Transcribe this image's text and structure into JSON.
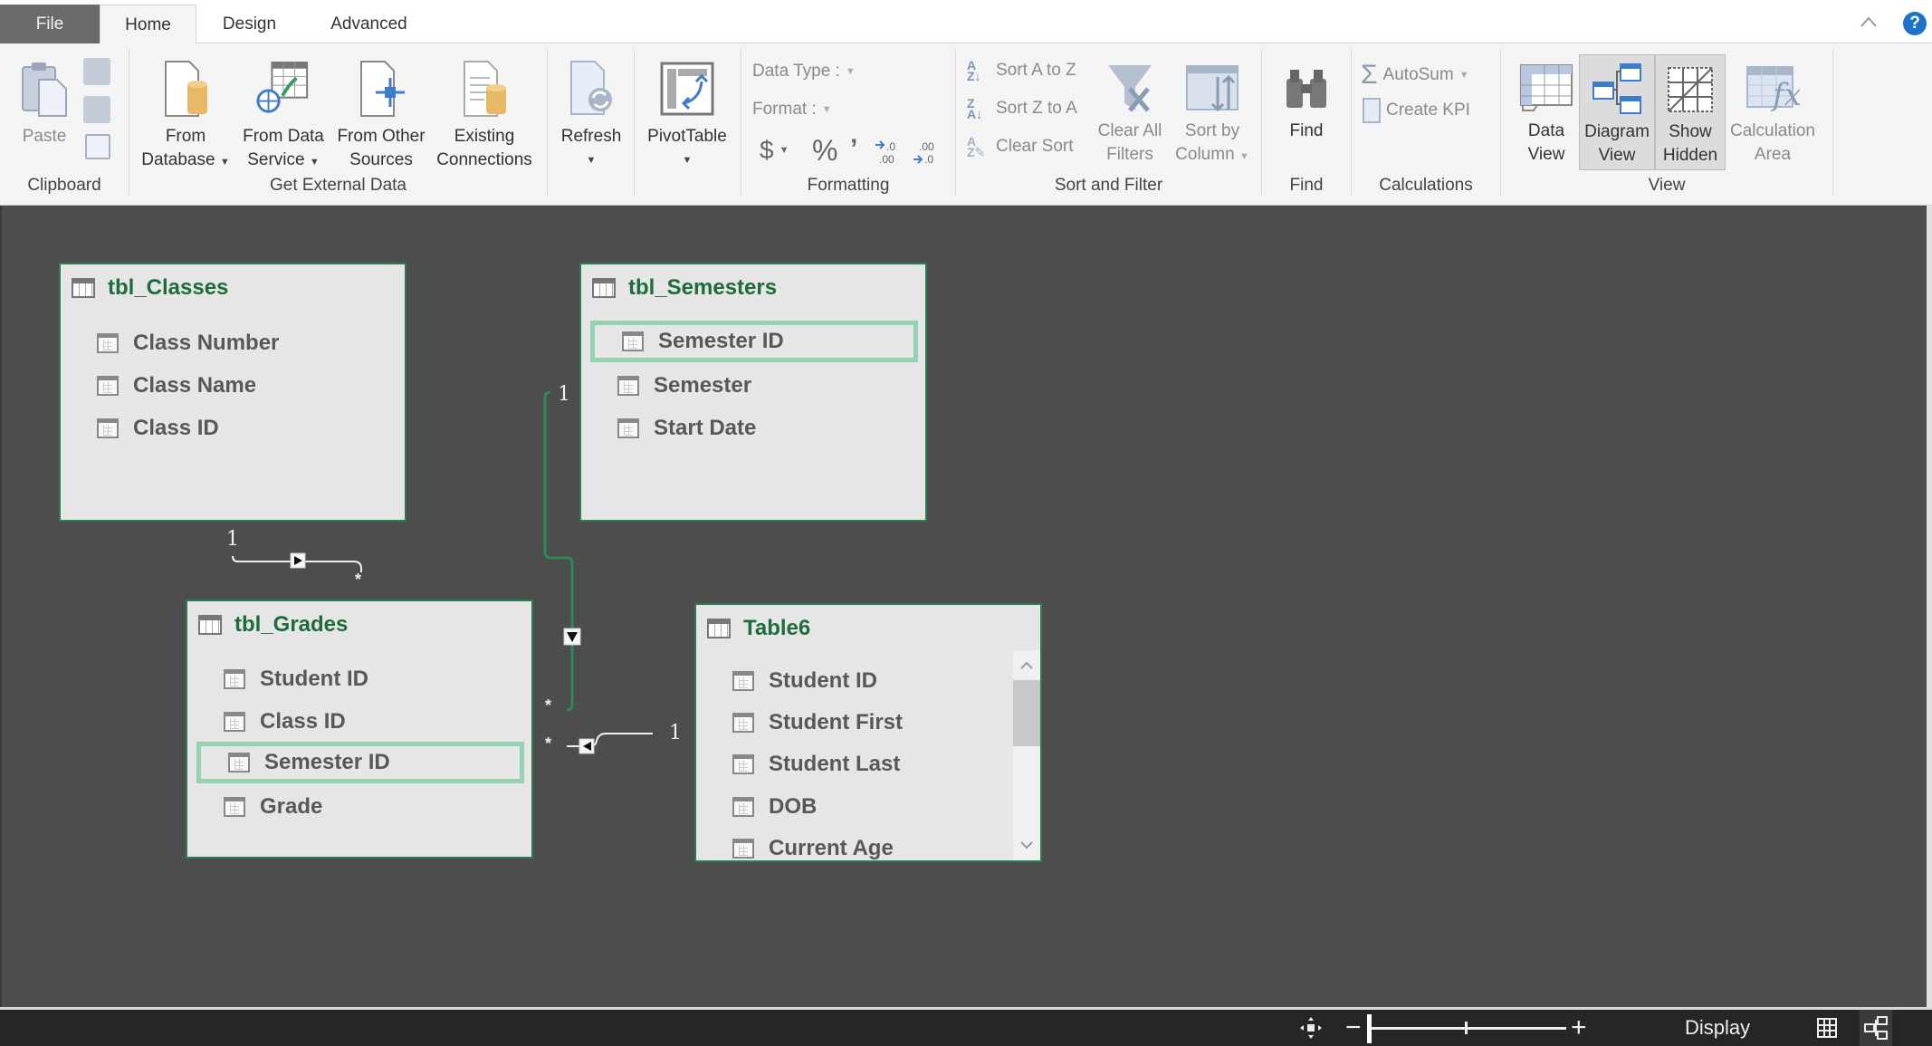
{
  "tabs": {
    "file": "File",
    "home": "Home",
    "design": "Design",
    "advanced": "Advanced",
    "active": "Home"
  },
  "help_label": "?",
  "collapse_label": "^",
  "ribbon": {
    "clipboard": {
      "label": "Clipboard",
      "paste": "Paste"
    },
    "get_external_data": {
      "label": "Get External Data",
      "from_database": [
        "From",
        "Database"
      ],
      "from_data_service": [
        "From Data",
        "Service"
      ],
      "from_other_sources": [
        "From Other",
        "Sources"
      ],
      "existing_connections": [
        "Existing",
        "Connections"
      ]
    },
    "refresh": {
      "label": "Refresh"
    },
    "pivottable": {
      "label": "PivotTable"
    },
    "formatting": {
      "label": "Formatting",
      "data_type": "Data Type :",
      "format": "Format :",
      "currency": "$",
      "percent": "%",
      "comma": "’"
    },
    "sort_filter": {
      "label": "Sort and Filter",
      "sort_az": "Sort A to Z",
      "sort_za": "Sort Z to A",
      "clear_sort": "Clear Sort",
      "clear_all_filters": [
        "Clear All",
        "Filters"
      ],
      "sort_by_column": [
        "Sort by",
        "Column"
      ]
    },
    "find": {
      "label": "Find",
      "button": "Find"
    },
    "calculations": {
      "label": "Calculations",
      "autosum": "AutoSum",
      "create_kpi": "Create KPI"
    },
    "view": {
      "label": "View",
      "data_view": [
        "Data",
        "View"
      ],
      "diagram_view": [
        "Diagram",
        "View"
      ],
      "show_hidden": [
        "Show",
        "Hidden"
      ],
      "calculation_area": [
        "Calculation",
        "Area"
      ]
    }
  },
  "diagram": {
    "tables": [
      {
        "name": "tbl_Classes",
        "columns": [
          "Class Number",
          "Class Name",
          "Class ID"
        ],
        "highlighted": null
      },
      {
        "name": "tbl_Semesters",
        "columns": [
          "Semester ID",
          "Semester",
          "Start Date"
        ],
        "highlighted": "Semester ID"
      },
      {
        "name": "tbl_Grades",
        "columns": [
          "Student ID",
          "Class ID",
          "Semester ID",
          "Grade"
        ],
        "highlighted": "Semester ID"
      },
      {
        "name": "Table6",
        "columns": [
          "Student ID",
          "Student First",
          "Student Last",
          "DOB",
          "Current Age"
        ],
        "highlighted": null
      }
    ],
    "relationships": [
      {
        "from": "tbl_Classes",
        "to": "tbl_Grades",
        "one": "1",
        "many": "*",
        "active": false
      },
      {
        "from": "tbl_Semesters",
        "to": "tbl_Grades",
        "one": "1",
        "many": "*",
        "active": true
      },
      {
        "from": "Table6",
        "to": "tbl_Grades",
        "one": "1",
        "many": "*",
        "active": false
      }
    ],
    "colors": {
      "active_relationship": "#2d8a55",
      "inactive_relationship": "#f0f0f0",
      "table_title": "#1e6b3c",
      "highlight": "#94d2b2"
    }
  },
  "statusbar": {
    "display_label": "Display",
    "zoom_minus": "−",
    "zoom_plus": "+",
    "zoom_level_fraction": 0.0
  }
}
